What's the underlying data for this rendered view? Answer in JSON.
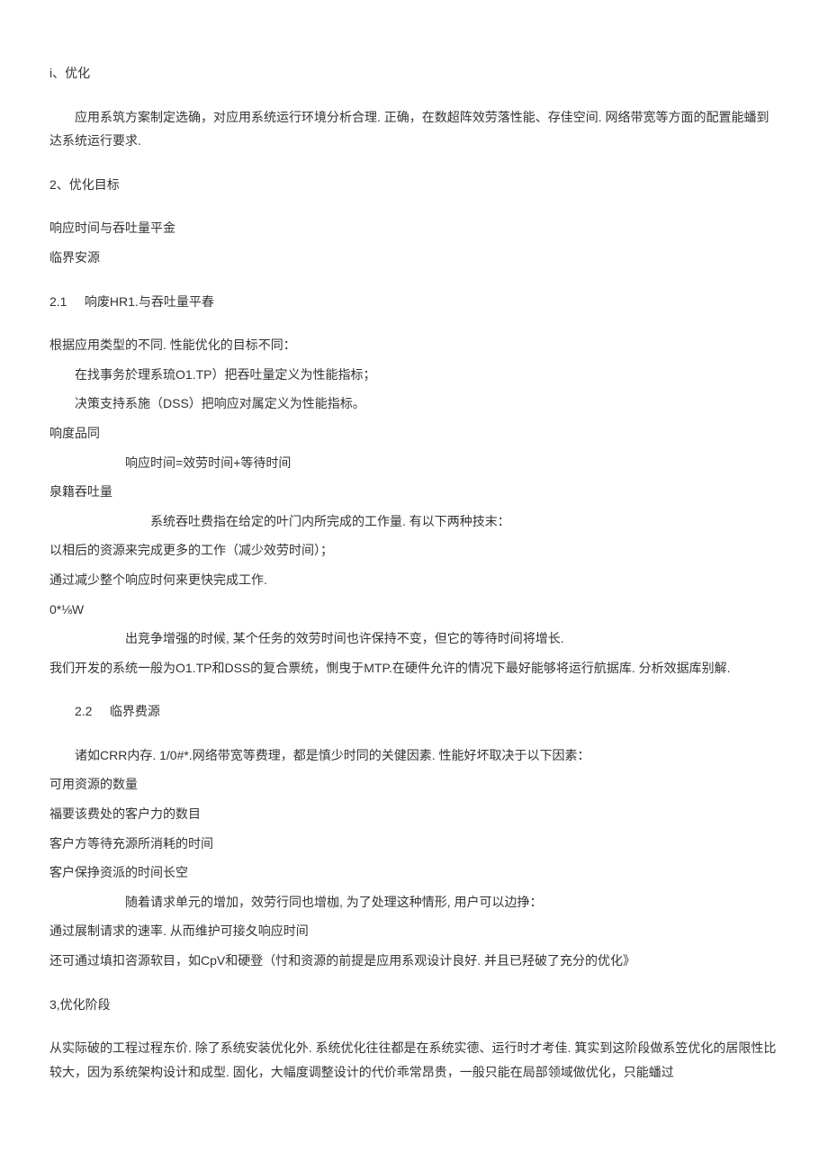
{
  "s1": {
    "title": "i、优化",
    "p1": "应用系筑方案制定选确，对应用系统运行环境分析合理. 正确，在数超阵效劳落性能、存佳空间. 网络带宽等方面的配置能蟠到达系统运行要求."
  },
  "s2": {
    "title": "2、优化目标",
    "l1": "响应时间与吞吐量平金",
    "l2": "临界安源"
  },
  "s21": {
    "title_num": "2.1",
    "title_text": "响废HR1.与吞吐量平春",
    "l1": "根据应用类型的不同. 性能优化的目标不同：",
    "l2": "在找事务於理系琉O1.TP）把吞吐量定义为性能指标；",
    "l3": "决策支持系施（DSS）把响应对属定义为性能指标。",
    "l4": "响度品同",
    "l5": "响应时间=效劳时间+等待时间",
    "l6": "泉籍吞吐量",
    "l7": "系统吞吐费指在给定的叶门内所完成的工作量. 有以下两种技末：",
    "l8": "以相后的资源来完成更多的工作（减少效劳时间）；",
    "l9": "通过减少整个响应时何来更快完成工作.",
    "l10": "0*⅛W",
    "l11": "出竞争增强的时候, 某个任务的效劳时间也许保持不变，但它的等待时间将增长.",
    "l12": "我们开发的系统一般为O1.TP和DSS的复合票统，惻曳于MTP.在硬件允许的情况下最好能够将运行航据库. 分析效据库别解."
  },
  "s22": {
    "title_num": "2.2",
    "title_text": "临界费源",
    "l1": "诸如CRR内存. 1/0#*.网络带宽等费理，都是慎少时同的关健因素. 性能好坏取决于以下因素：",
    "l2": "可用资源的数量",
    "l3": "福要该费处的客户力的数目",
    "l4": "客户方等待充源所消耗的时间",
    "l5": "客户保挣资派的时间长空",
    "l6": "随着请求单元的增加，效劳行同也增枷, 为了处理这种情形, 用户可以边挣：",
    "l7": "通过展制请求的速率. 从而维护可接夂响应时间",
    "l8": "还可通过填扣咨源软目，如CpV和硬登（忖和资源的前提是应用系观设计良好. 并且已羟破了充分的优化》"
  },
  "s3": {
    "title": "3,优化阶段",
    "p1": "从实际破的工程过程东价. 除了系统安装优化外. 系统优化往往都是在系统实德、运行时才考佳. 箕实到这阶段做系笠优化的居限性比较大，因为系统架构设计和成型. 固化，大幅度调整设计的代价乖常昂贵，一般只能在局部领域做优化，只能蟠过"
  }
}
